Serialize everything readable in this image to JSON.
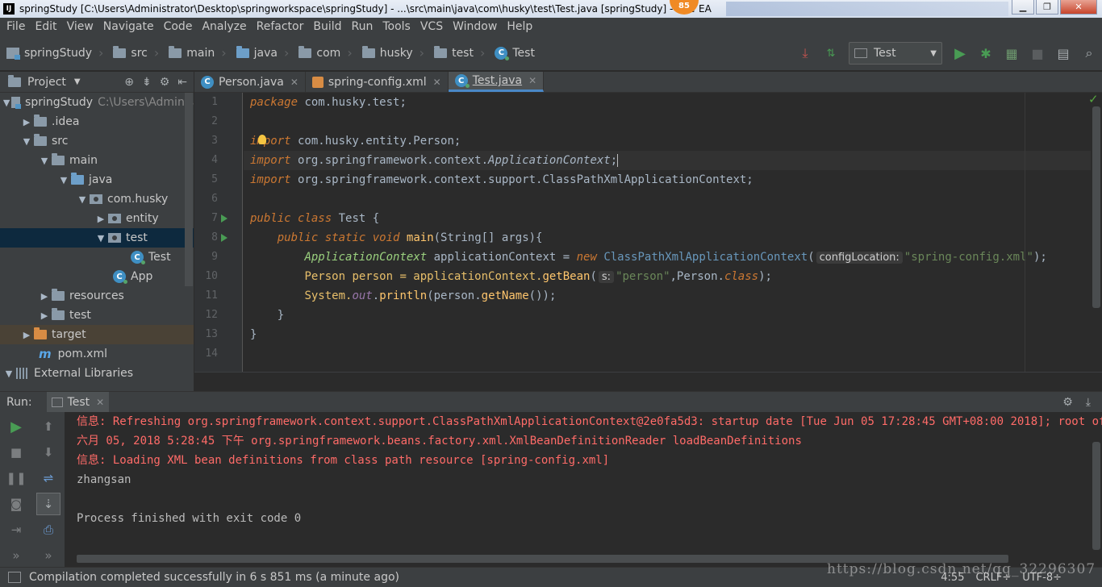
{
  "window": {
    "title": "springStudy [C:\\Users\\Administrator\\Desktop\\springworkspace\\springStudy] - ...\\src\\main\\java\\com\\husky\\test\\Test.java [springStudy] - Inte",
    "title_tail": "EA",
    "badge": "85",
    "app_icon": "IJ"
  },
  "menu": [
    "File",
    "Edit",
    "View",
    "Navigate",
    "Code",
    "Analyze",
    "Refactor",
    "Build",
    "Run",
    "Tools",
    "VCS",
    "Window",
    "Help"
  ],
  "breadcrumbs": [
    "springStudy",
    "src",
    "main",
    "java",
    "com",
    "husky",
    "test",
    "Test"
  ],
  "run_config": {
    "label": "Test"
  },
  "project_panel": {
    "title": "Project",
    "tree": [
      {
        "label": "springStudy",
        "path": "C:\\Users\\Adminis",
        "depth": 0,
        "open": true,
        "icon": "project"
      },
      {
        "label": ".idea",
        "depth": 1,
        "open": false,
        "icon": "folder"
      },
      {
        "label": "src",
        "depth": 1,
        "open": true,
        "icon": "folder"
      },
      {
        "label": "main",
        "depth": 2,
        "open": true,
        "icon": "folder"
      },
      {
        "label": "java",
        "depth": 3,
        "open": true,
        "icon": "folder-blue"
      },
      {
        "label": "com.husky",
        "depth": 4,
        "open": true,
        "icon": "package"
      },
      {
        "label": "entity",
        "depth": 5,
        "open": false,
        "icon": "package"
      },
      {
        "label": "test",
        "depth": 5,
        "open": true,
        "icon": "package",
        "selected": true
      },
      {
        "label": "Test",
        "depth": 6,
        "icon": "class"
      },
      {
        "label": "App",
        "depth": 5,
        "icon": "class"
      },
      {
        "label": "resources",
        "depth": 2,
        "open": false,
        "icon": "folder"
      },
      {
        "label": "test",
        "depth": 2,
        "open": false,
        "icon": "folder"
      },
      {
        "label": "target",
        "depth": 1,
        "open": false,
        "icon": "folder-orange"
      },
      {
        "label": "pom.xml",
        "depth": 1,
        "icon": "maven"
      },
      {
        "label": "External Libraries",
        "depth": 0,
        "open": true,
        "icon": "libs"
      }
    ]
  },
  "editor_tabs": [
    {
      "label": "Person.java",
      "icon": "class",
      "active": false
    },
    {
      "label": "spring-config.xml",
      "icon": "xml",
      "active": false
    },
    {
      "label": "Test.java",
      "icon": "class",
      "active": true
    }
  ],
  "editor": {
    "line_numbers": [
      "1",
      "2",
      "3",
      "4",
      "5",
      "6",
      "7",
      "8",
      "9",
      "10",
      "11",
      "12",
      "13",
      "14"
    ],
    "code": {
      "l1_kw": "package",
      "l1_rest": " com.husky.test;",
      "l3_kw": "import",
      "l3_rest": " com.husky.entity.Person;",
      "l4_kw": "import",
      "l4_pre": " org.springframework.context.",
      "l4_iface": "ApplicationContext",
      "l4_end": ";",
      "l5_kw": "import",
      "l5_rest": " org.springframework.context.support.ClassPathXmlApplicationContext;",
      "l7_kw1": "public",
      "l7_kw2": "class",
      "l7_rest": " Test {",
      "l8_kw1": "public",
      "l8_kw2": "static",
      "l8_kw3": "void",
      "l8_fn": "main",
      "l8_rest": "(String[] args){",
      "l9_type": "ApplicationContext",
      "l9_var": " applicationContext = ",
      "l9_new": "new",
      "l9_cls": " ClassPathXmlApplicationContext",
      "l9_paren": "(",
      "l9_hint": "configLocation:",
      "l9_str": "\"spring-config.xml\"",
      "l9_end": ");",
      "l10_a": "Person person = applicationContext.",
      "l10_fn": "getBean",
      "l10_paren": "(",
      "l10_hint": "s:",
      "l10_str": "\"person\"",
      "l10_mid": ",Person.",
      "l10_kw": "class",
      "l10_end": ");",
      "l11_a": "System.",
      "l11_field": "out",
      "l11_b": ".",
      "l11_fn": "println",
      "l11_c": "(person.",
      "l11_fn2": "getName",
      "l11_d": "());",
      "l12": "}",
      "l13": "}"
    }
  },
  "run_panel": {
    "label": "Run:",
    "tab": "Test",
    "console": [
      {
        "text": "信息: Refreshing org.springframework.context.support.ClassPathXmlApplicationContext@2e0fa5d3: startup date [Tue Jun 05 17:28:45 GMT+08:00 2018]; root of context hierarchy",
        "type": "err"
      },
      {
        "text": "六月 05, 2018 5:28:45 下午 org.springframework.beans.factory.xml.XmlBeanDefinitionReader loadBeanDefinitions",
        "type": "err"
      },
      {
        "text": "信息: Loading XML bean definitions from class path resource [spring-config.xml]",
        "type": "err"
      },
      {
        "text": "zhangsan",
        "type": "out"
      },
      {
        "text": "",
        "type": "out"
      },
      {
        "text": "Process finished with exit code 0",
        "type": "out"
      }
    ]
  },
  "status": {
    "message": "Compilation completed successfully in 6 s 851 ms (a minute ago)",
    "position": "4:55",
    "line_sep": "CRLF÷",
    "encoding": "UTF-8÷"
  },
  "watermark": "https://blog.csdn.net/qq_32296307"
}
